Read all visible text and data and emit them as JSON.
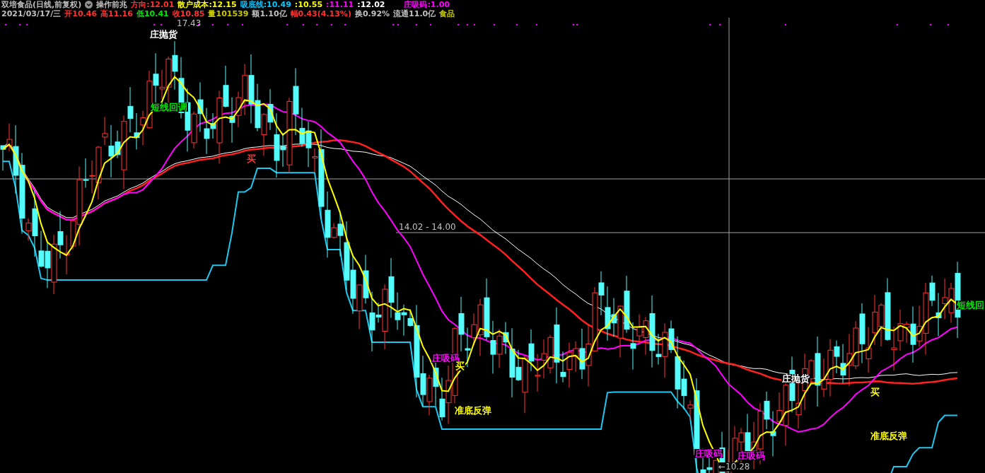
{
  "header": {
    "title": "双培食品(日线,前复权)",
    "indicator": "操作前兆",
    "values": [
      {
        "text": "方向:12.01",
        "color": "#ff3232"
      },
      {
        "text": "散户成本:12.15",
        "color": "#ffff00"
      },
      {
        "text": "吸底线:10.49",
        "color": "#00c8ff"
      },
      {
        "text": ":10.55",
        "color": "#ffff00"
      },
      {
        "text": ":11.11",
        "color": "#ff00ff"
      },
      {
        "text": ":12.02",
        "color": "#ffffff"
      },
      {
        "text": "庄吸码:1.00",
        "color": "#ff00ff"
      }
    ]
  },
  "quote": [
    {
      "text": "2021/03/17/三",
      "color": "#c0c0c0"
    },
    {
      "text": "开10.46",
      "color": "#ff3232"
    },
    {
      "text": "高11.16",
      "color": "#ff3232"
    },
    {
      "text": "低10.41",
      "color": "#00e600"
    },
    {
      "text": "收10.85",
      "color": "#ff3232"
    },
    {
      "text": "量101539",
      "color": "#c8c800"
    },
    {
      "text": "额1.10亿",
      "color": "#c0c0c0"
    },
    {
      "text": "幅0.43(4.13%)",
      "color": "#ff3232"
    },
    {
      "text": "换0.92%",
      "color": "#c0c0c0"
    },
    {
      "text": "流通11.0亿",
      "color": "#c0c0c0"
    },
    {
      "text": "食品",
      "color": "#c8c800"
    }
  ],
  "chart": {
    "max_label": "17.43",
    "min_label": "←10.28",
    "crosshair_label": "14.02 - 14.00",
    "annotations": [
      {
        "text": "庄抛货",
        "color": "#ffffff"
      },
      {
        "text": "短线回调",
        "color": "#00e600"
      },
      {
        "text": "买",
        "color": "#ff3232"
      },
      {
        "text": "庄吸码",
        "color": "#ff00ff"
      },
      {
        "text": "买",
        "color": "#ffff00"
      },
      {
        "text": "准底反弹",
        "color": "#ffff00"
      },
      {
        "text": "庄抛货",
        "color": "#ffffff"
      },
      {
        "text": "买",
        "color": "#ffff00"
      },
      {
        "text": "庄吸码",
        "color": "#ff00ff"
      },
      {
        "text": "庄吸码",
        "color": "#ff00ff"
      },
      {
        "text": "准底反弹",
        "color": "#ffff00"
      },
      {
        "text": "短线回",
        "color": "#00e600"
      }
    ]
  }
}
